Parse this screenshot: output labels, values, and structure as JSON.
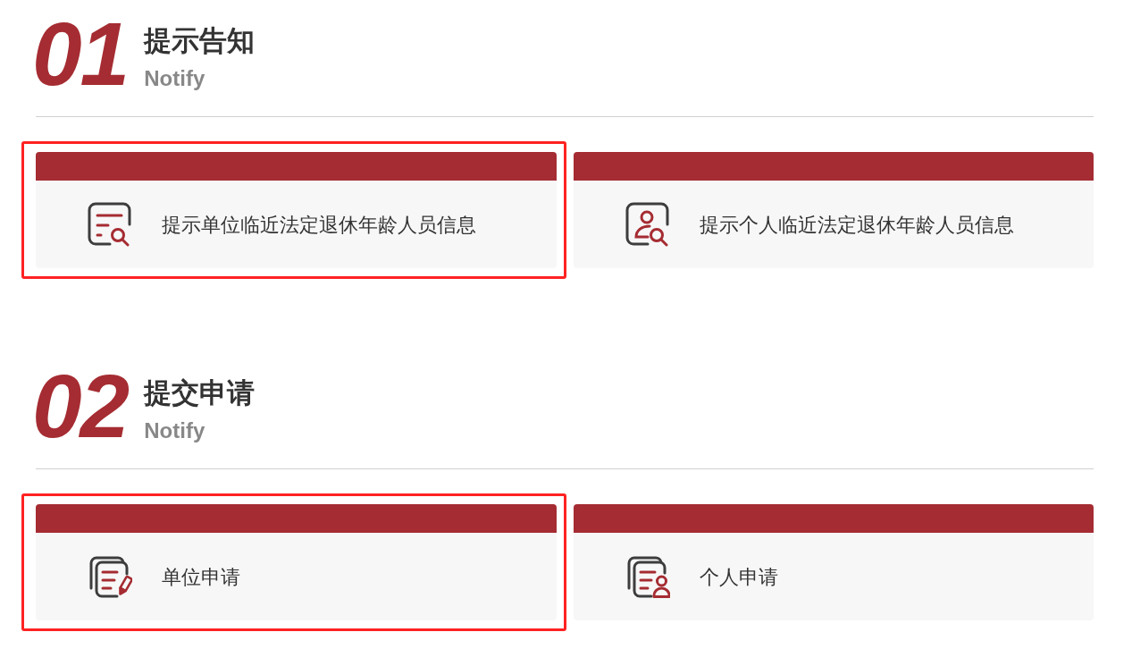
{
  "sections": [
    {
      "number": "01",
      "title": "提示告知",
      "subtitle": "Notify",
      "cards": [
        {
          "label": "提示单位临近法定退休年龄人员信息",
          "highlighted": true
        },
        {
          "label": "提示个人临近法定退休年龄人员信息",
          "highlighted": false
        }
      ]
    },
    {
      "number": "02",
      "title": "提交申请",
      "subtitle": "Notify",
      "cards": [
        {
          "label": "单位申请",
          "highlighted": true
        },
        {
          "label": "个人申请",
          "highlighted": false
        }
      ]
    }
  ]
}
